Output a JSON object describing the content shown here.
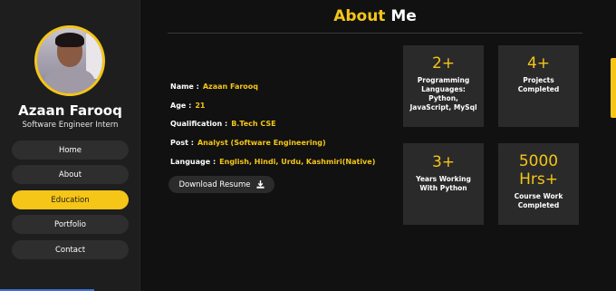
{
  "profile": {
    "name": "Azaan Farooq",
    "role": "Software Engineer Intern"
  },
  "nav": {
    "items": [
      {
        "label": "Home"
      },
      {
        "label": "About"
      },
      {
        "label": "Education"
      },
      {
        "label": "Portfolio"
      },
      {
        "label": "Contact"
      }
    ],
    "active": "Education"
  },
  "header": {
    "title_accent": "About",
    "title_rest": "Me"
  },
  "info": [
    {
      "label": "Name :",
      "value": "Azaan Farooq"
    },
    {
      "label": "Age :",
      "value": "21"
    },
    {
      "label": "Qualification :",
      "value": "B.Tech CSE"
    },
    {
      "label": "Post :",
      "value": "Analyst (Software Engineering)"
    },
    {
      "label": "Language :",
      "value": "English, Hindi, Urdu, Kashmiri(Native)"
    }
  ],
  "download": {
    "label": "Download Resume",
    "icon": "download-icon"
  },
  "stats": [
    {
      "number": "2+",
      "lines": [
        "Programming",
        "Languages:",
        "Python,",
        "JavaScript, MySql"
      ]
    },
    {
      "number": "4+",
      "lines": [
        "Projects",
        "Completed"
      ]
    },
    {
      "number": "3+",
      "lines": [
        "Years Working",
        "With Python"
      ]
    },
    {
      "number": "5000",
      "number2": "Hrs+",
      "lines": [
        "Course Work",
        "Completed"
      ]
    }
  ],
  "colors": {
    "accent": "#f5c518",
    "background": "#111111",
    "sidebar": "#1e1e1e",
    "card": "#2a2a2a"
  }
}
